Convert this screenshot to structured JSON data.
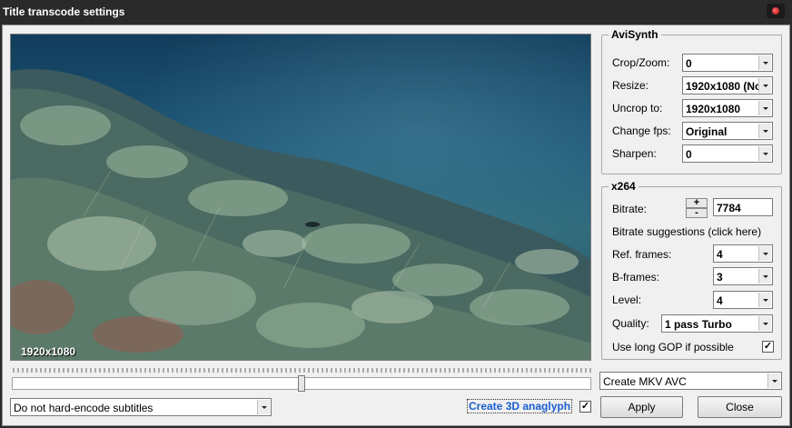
{
  "window": {
    "title": "Title transcode settings"
  },
  "preview": {
    "resolution_label": "1920x1080"
  },
  "avisynth": {
    "legend": "AviSynth",
    "crop_zoom": {
      "label": "Crop/Zoom:",
      "value": "0"
    },
    "resize": {
      "label": "Resize:",
      "value": "1920x1080 (No"
    },
    "uncrop_to": {
      "label": "Uncrop to:",
      "value": "1920x1080"
    },
    "change_fps": {
      "label": "Change fps:",
      "value": "Original"
    },
    "sharpen": {
      "label": "Sharpen:",
      "value": "0"
    }
  },
  "x264": {
    "legend": "x264",
    "bitrate": {
      "label": "Bitrate:",
      "value": "7784",
      "plus": "+",
      "minus": "-"
    },
    "bitrate_suggestions": "Bitrate suggestions (click here)",
    "ref_frames": {
      "label": "Ref. frames:",
      "value": "4"
    },
    "b_frames": {
      "label": "B-frames:",
      "value": "3"
    },
    "level": {
      "label": "Level:",
      "value": "4"
    },
    "quality": {
      "label": "Quality:",
      "value": "1 pass Turbo"
    },
    "long_gop": {
      "label": "Use long GOP if possible",
      "checked": true,
      "mark": "✓"
    }
  },
  "timeline": {
    "position": 0.5
  },
  "output_format": {
    "value": "Create MKV AVC"
  },
  "subtitles": {
    "value": "Do not hard-encode subtitles"
  },
  "anaglyph": {
    "label": "Create 3D anaglyph",
    "checked": true,
    "mark": "✓"
  },
  "buttons": {
    "apply": "Apply",
    "close": "Close"
  }
}
